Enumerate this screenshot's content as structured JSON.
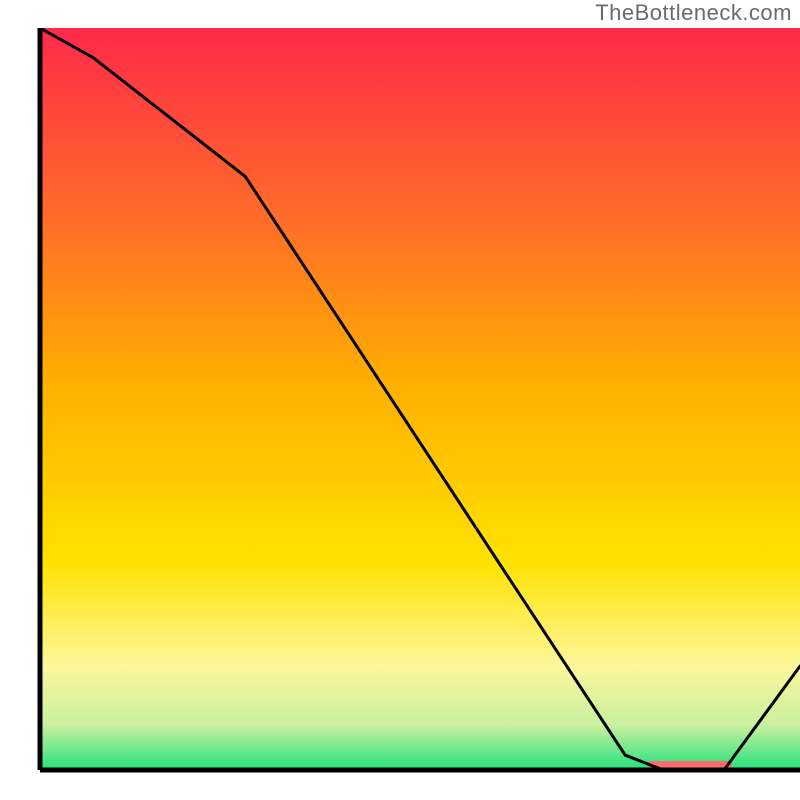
{
  "attribution": "TheBottleneck.com",
  "chart_data": {
    "type": "line",
    "title": "",
    "xlabel": "",
    "ylabel": "",
    "xlim": [
      0,
      100
    ],
    "ylim": [
      0,
      100
    ],
    "x": [
      0,
      7,
      27,
      77,
      82,
      90,
      100
    ],
    "values": [
      100,
      96,
      80,
      2,
      0,
      0,
      14
    ],
    "marker": {
      "x_range": [
        80,
        91
      ],
      "y": 0,
      "color": "#ff6b6b"
    },
    "gradient_stops": [
      {
        "offset": 0.0,
        "color": "#ff2a4a"
      },
      {
        "offset": 0.25,
        "color": "#ff6a2a"
      },
      {
        "offset": 0.48,
        "color": "#ffb000"
      },
      {
        "offset": 0.72,
        "color": "#ffe200"
      },
      {
        "offset": 0.86,
        "color": "#fdf79b"
      },
      {
        "offset": 0.94,
        "color": "#c9f0a0"
      },
      {
        "offset": 1.0,
        "color": "#23e27a"
      }
    ],
    "axes_color": "#000000",
    "line_color": "#000000",
    "line_width": 3
  }
}
